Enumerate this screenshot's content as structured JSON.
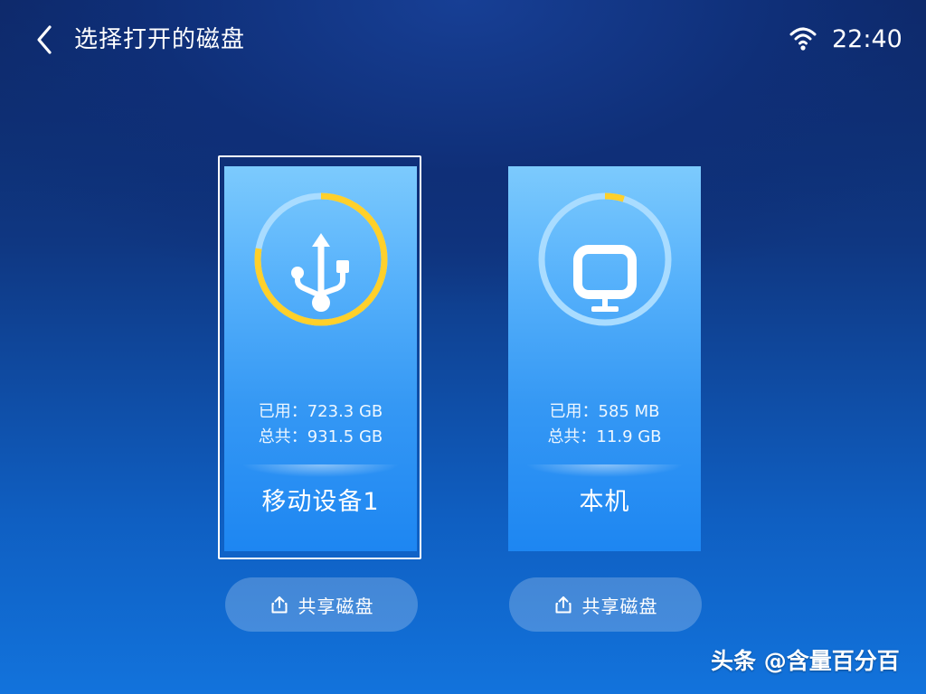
{
  "header": {
    "back_icon": "chevron-left-icon",
    "title": "选择打开的磁盘",
    "wifi_icon": "wifi-icon",
    "time": "22:40"
  },
  "disks": [
    {
      "icon": "usb-icon",
      "name": "移动设备1",
      "used_label": "已用：723.3 GB",
      "total_label": "总共：931.5 GB",
      "usage_fraction": 0.777,
      "selected": true
    },
    {
      "icon": "monitor-icon",
      "name": "本机",
      "used_label": "已用：585 MB",
      "total_label": "总共：11.9 GB",
      "usage_fraction": 0.048,
      "selected": false
    }
  ],
  "share_buttons": [
    {
      "icon": "share-upload-icon",
      "label": "共享磁盘"
    },
    {
      "icon": "share-upload-icon",
      "label": "共享磁盘"
    }
  ],
  "watermark": "头条 @含量百分百",
  "colors": {
    "usage_ring": "#ffd02a",
    "ring_track": "#a9dcff"
  }
}
